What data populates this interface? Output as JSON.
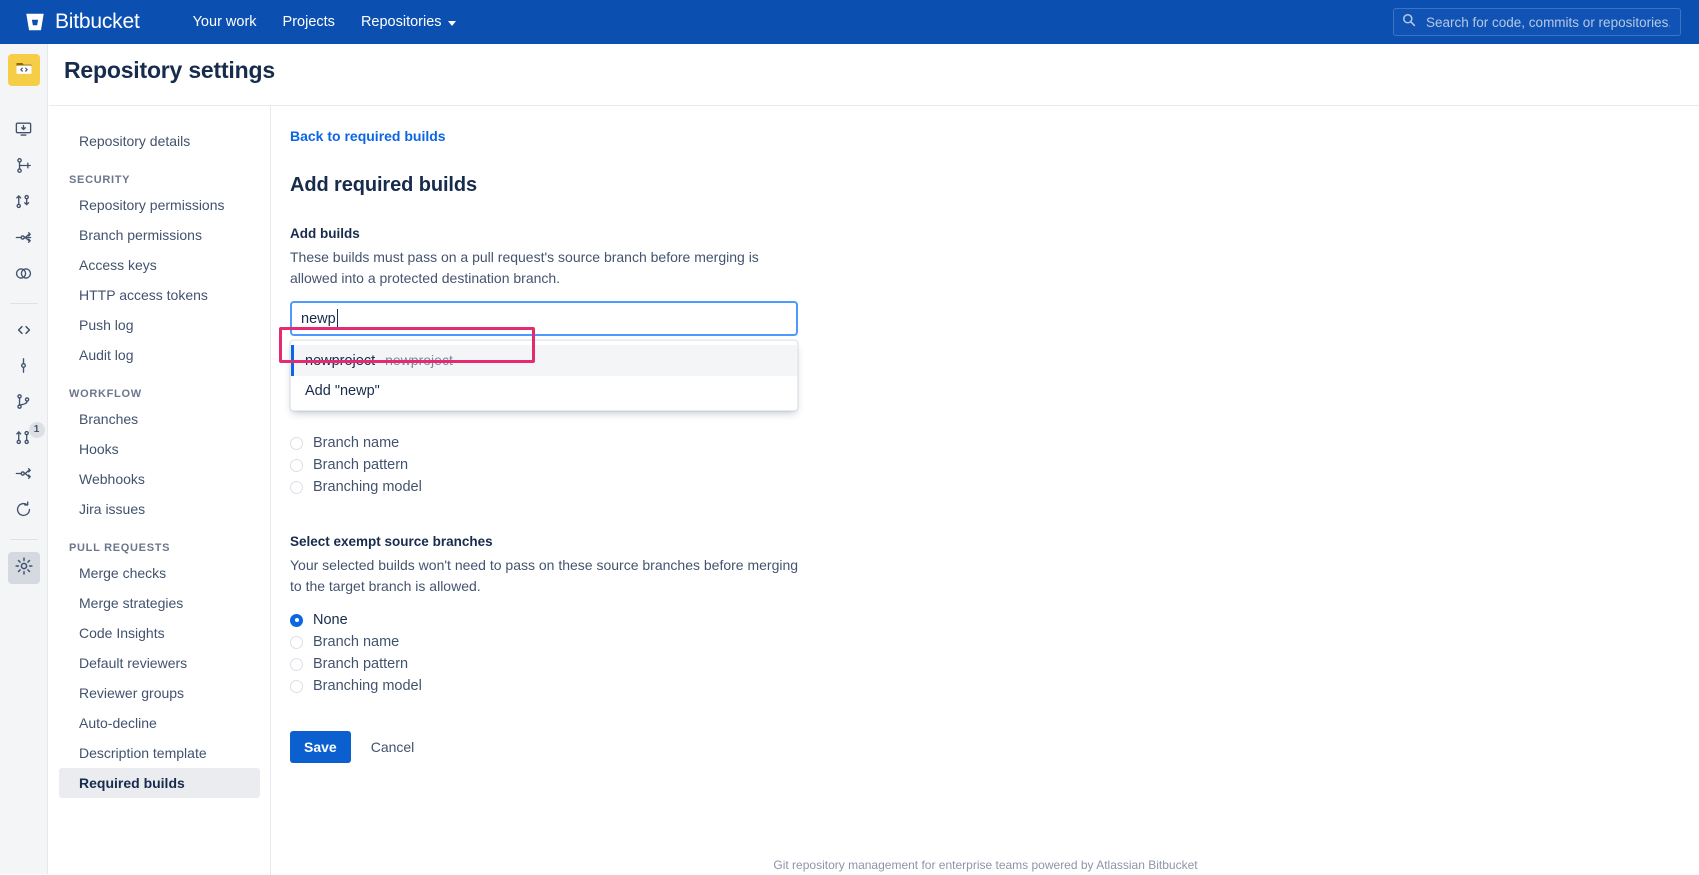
{
  "topnav": {
    "brand": "Bitbucket",
    "brand_icon": "bitbucket-logo-icon",
    "links": [
      {
        "label": "Your work",
        "icon": null
      },
      {
        "label": "Projects",
        "icon": null
      },
      {
        "label": "Repositories",
        "icon": "chevron-down-icon"
      }
    ],
    "search": {
      "icon": "search-icon",
      "placeholder": "Search for code, commits or repositories...",
      "value": ""
    },
    "background_color": "#0b4fb0"
  },
  "rail": {
    "items": [
      {
        "name": "repository-logo",
        "icon": "code-folder-icon",
        "badge": null,
        "active": false
      },
      {
        "name": "clone-icon",
        "icon": "clone-repository-icon",
        "badge": null,
        "active": false
      },
      {
        "name": "create-branch-icon",
        "icon": "create-branch-icon",
        "badge": null,
        "active": false
      },
      {
        "name": "create-pull-request-icon",
        "icon": "create-pull-request-icon",
        "badge": null,
        "active": false
      },
      {
        "name": "fork-icon",
        "icon": "fork-repository-icon",
        "badge": null,
        "active": false
      },
      {
        "name": "compare-icon",
        "icon": "compare-branches-icon",
        "badge": null,
        "active": false
      },
      {
        "name": "source-icon",
        "icon": "source-code-icon",
        "badge": null,
        "active": false
      },
      {
        "name": "commits-icon",
        "icon": "commits-icon",
        "badge": null,
        "active": false
      },
      {
        "name": "branches-icon",
        "icon": "branches-icon",
        "badge": null,
        "active": false
      },
      {
        "name": "pull-requests-icon",
        "icon": "pull-requests-icon",
        "badge": "1",
        "active": false
      },
      {
        "name": "forks-icon",
        "icon": "forks-icon",
        "badge": null,
        "active": false
      },
      {
        "name": "pipelines-icon",
        "icon": "pipelines-icon",
        "badge": null,
        "active": false
      },
      {
        "name": "repository-settings-icon",
        "icon": "gear-icon",
        "badge": null,
        "active": true
      }
    ]
  },
  "page": {
    "title": "Repository settings"
  },
  "settings_nav": {
    "top_item": "Repository details",
    "sections": [
      {
        "label": "Security",
        "items": [
          "Repository permissions",
          "Branch permissions",
          "Access keys",
          "HTTP access tokens",
          "Push log",
          "Audit log"
        ]
      },
      {
        "label": "Workflow",
        "items": [
          "Branches",
          "Hooks",
          "Webhooks",
          "Jira issues"
        ]
      },
      {
        "label": "Pull requests",
        "items": [
          "Merge checks",
          "Merge strategies",
          "Code Insights",
          "Default reviewers",
          "Reviewer groups",
          "Auto-decline",
          "Description template",
          "Required builds"
        ]
      }
    ],
    "selected": "Required builds"
  },
  "main": {
    "back_link": "Back to required builds",
    "heading": "Add required builds",
    "add_builds": {
      "label": "Add builds",
      "help": "These builds must pass on a pull request's source branch before merging is allowed into a protected destination branch.",
      "input_value": "newp",
      "input_placeholder": "",
      "dropdown": {
        "options": [
          {
            "primary": "newproject",
            "secondary": "newproject",
            "highlighted": true
          },
          {
            "primary": "Add \"newp\"",
            "secondary": "",
            "highlighted": false
          }
        ]
      }
    },
    "source_branch_radios": {
      "options": [
        "Branch name",
        "Branch pattern",
        "Branching model"
      ],
      "selected": null
    },
    "exempt": {
      "label": "Select exempt source branches",
      "help": "Your selected builds won't need to pass on these source branches before merging to the target branch is allowed.",
      "options": [
        "None",
        "Branch name",
        "Branch pattern",
        "Branching model"
      ],
      "selected": "None"
    },
    "buttons": {
      "save": "Save",
      "cancel": "Cancel"
    }
  },
  "footer": {
    "text": "Git repository management for enterprise teams powered by Atlassian Bitbucket"
  },
  "colors": {
    "nav_blue": "#0b4fb0",
    "link_blue": "#0c66e4",
    "primary_button": "#0c5fce",
    "annotation_pink": "#e42a70",
    "repo_logo_yellow": "#f5cd47"
  }
}
